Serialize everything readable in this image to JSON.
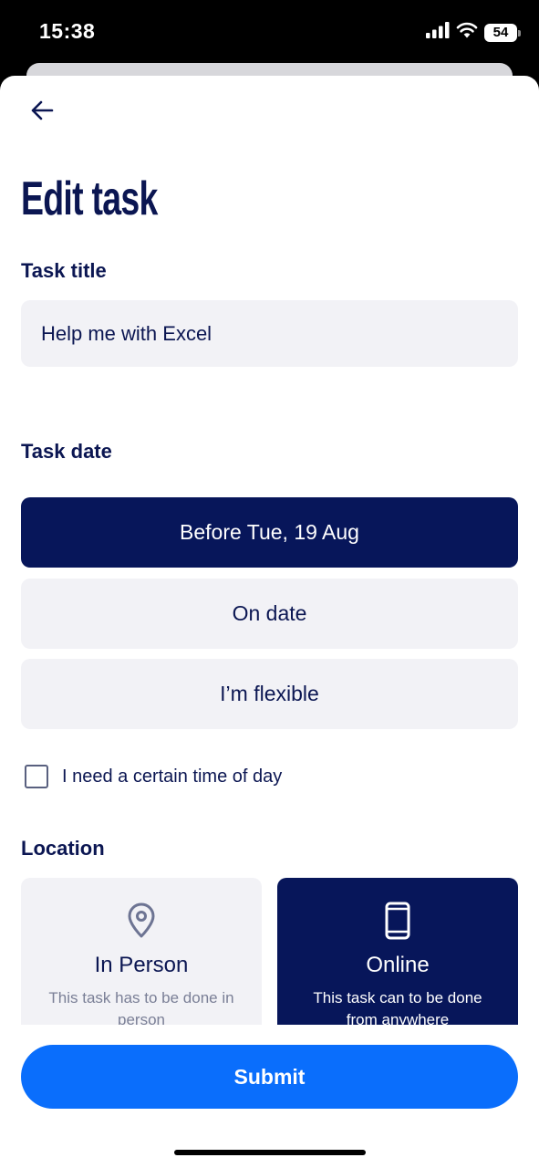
{
  "status_bar": {
    "time": "15:38",
    "battery": "54"
  },
  "header": {
    "title": "Edit task"
  },
  "task_title": {
    "label": "Task title",
    "value": "Help me with Excel"
  },
  "task_date": {
    "label": "Task date",
    "options": [
      {
        "label": "Before Tue, 19 Aug",
        "selected": true
      },
      {
        "label": "On date",
        "selected": false
      },
      {
        "label": "I’m flexible",
        "selected": false
      }
    ],
    "time_of_day_checkbox": {
      "label": "I need a certain time of day",
      "checked": false
    }
  },
  "location": {
    "label": "Location",
    "options": [
      {
        "title": "In Person",
        "description": "This task has to be done in person",
        "icon": "map-pin-icon",
        "selected": false
      },
      {
        "title": "Online",
        "description": "This task can to be done from anywhere",
        "icon": "phone-icon",
        "selected": true
      }
    ]
  },
  "footer": {
    "submit_label": "Submit"
  },
  "colors": {
    "navy": "#07165a",
    "accent_blue": "#0a6efc",
    "field_bg": "#f2f2f6"
  }
}
